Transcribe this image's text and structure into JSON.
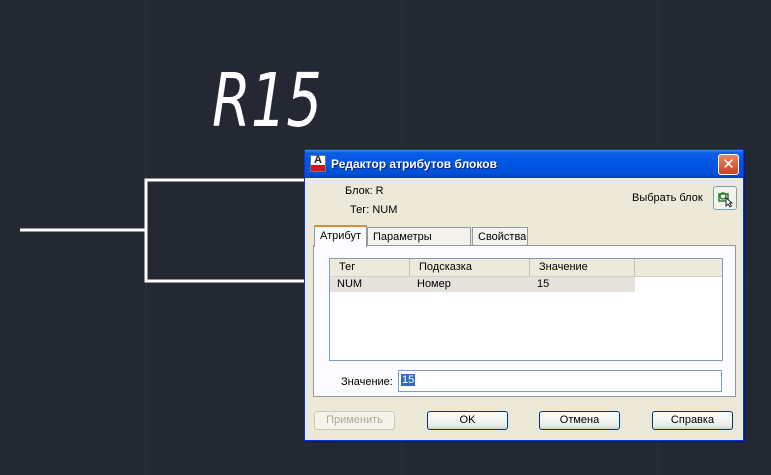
{
  "canvas": {
    "dimension_text": "R15"
  },
  "dialog": {
    "title": "Редактор атрибутов блоков",
    "block_label": "Блок: R",
    "tag_label": "Тег: NUM",
    "select_block_label": "Выбрать блок",
    "tabs": [
      {
        "label": "Атрибут",
        "active": true
      },
      {
        "label": "Параметры текста",
        "active": false
      },
      {
        "label": "Свойства",
        "active": false
      }
    ],
    "table": {
      "columns": [
        "Тег",
        "Подсказка",
        "Значение"
      ],
      "rows": [
        {
          "tag": "NUM",
          "prompt": "Номер",
          "value": "15"
        }
      ]
    },
    "value_label": "Значение:",
    "value_input": "15",
    "buttons": {
      "apply": "Применить",
      "ok": "OK",
      "cancel": "Отмена",
      "help": "Справка"
    }
  },
  "colors": {
    "canvas_bg": "#232833",
    "lines": "#ffffff",
    "titlebar": "#0054e3",
    "dialog_bg": "#ece9d8",
    "selection": "#316ac5"
  }
}
